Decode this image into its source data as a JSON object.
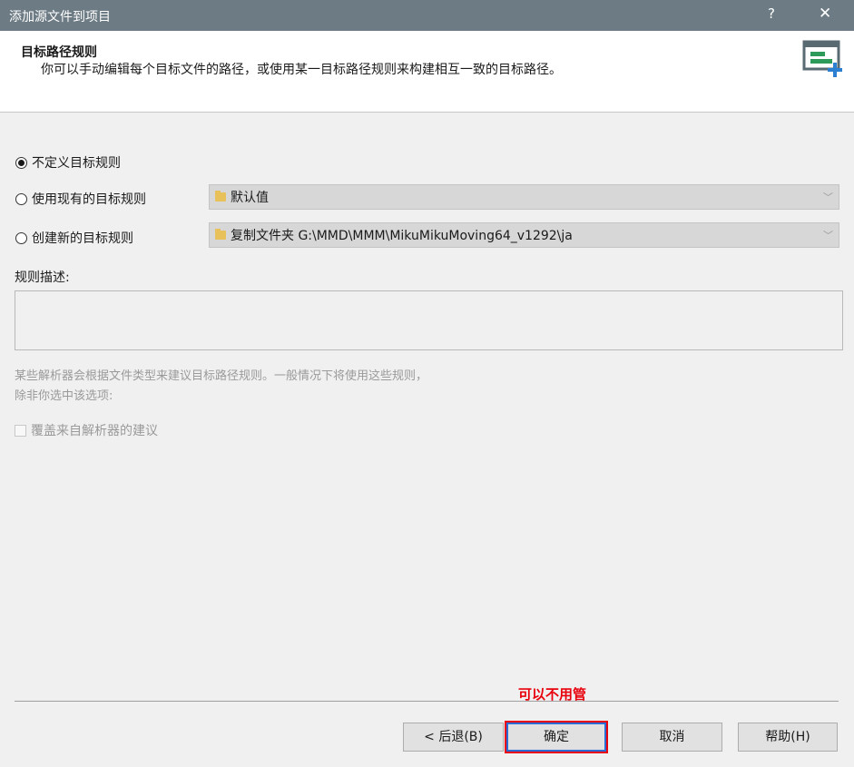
{
  "window": {
    "title": "添加源文件到项目",
    "help_glyph": "?",
    "close_glyph": "✕"
  },
  "header": {
    "title": "目标路径规则",
    "description": "你可以手动编辑每个目标文件的路径，或使用某一目标路径规则来构建相互一致的目标路径。",
    "icon": "add-file-icon"
  },
  "options": {
    "no_rule": {
      "label": "不定义目标规则",
      "selected": true
    },
    "existing_rule": {
      "label": "使用现有的目标规则",
      "selected": false,
      "value": "默认值"
    },
    "new_rule": {
      "label": "创建新的目标规则",
      "selected": false,
      "value": "复制文件夹 G:\\MMD\\MMM\\MikuMikuMoving64_v1292\\ja"
    }
  },
  "rule_description": {
    "label": "规则描述:",
    "value": ""
  },
  "hint": {
    "line1": "某些解析器会根据文件类型来建议目标路径规则。一般情况下将使用这些规则，",
    "line2": "除非你选中该选项:"
  },
  "override_checkbox": {
    "label": "覆盖来自解析器的建议",
    "checked": false
  },
  "annotation": "可以不用管",
  "buttons": {
    "back": "< 后退(B)",
    "ok": "确定",
    "cancel": "取消",
    "help": "帮助(H)"
  },
  "colors": {
    "titlebar": "#6d7b84",
    "annotation": "#e8000c",
    "primary_border": "#2b6bd6"
  }
}
